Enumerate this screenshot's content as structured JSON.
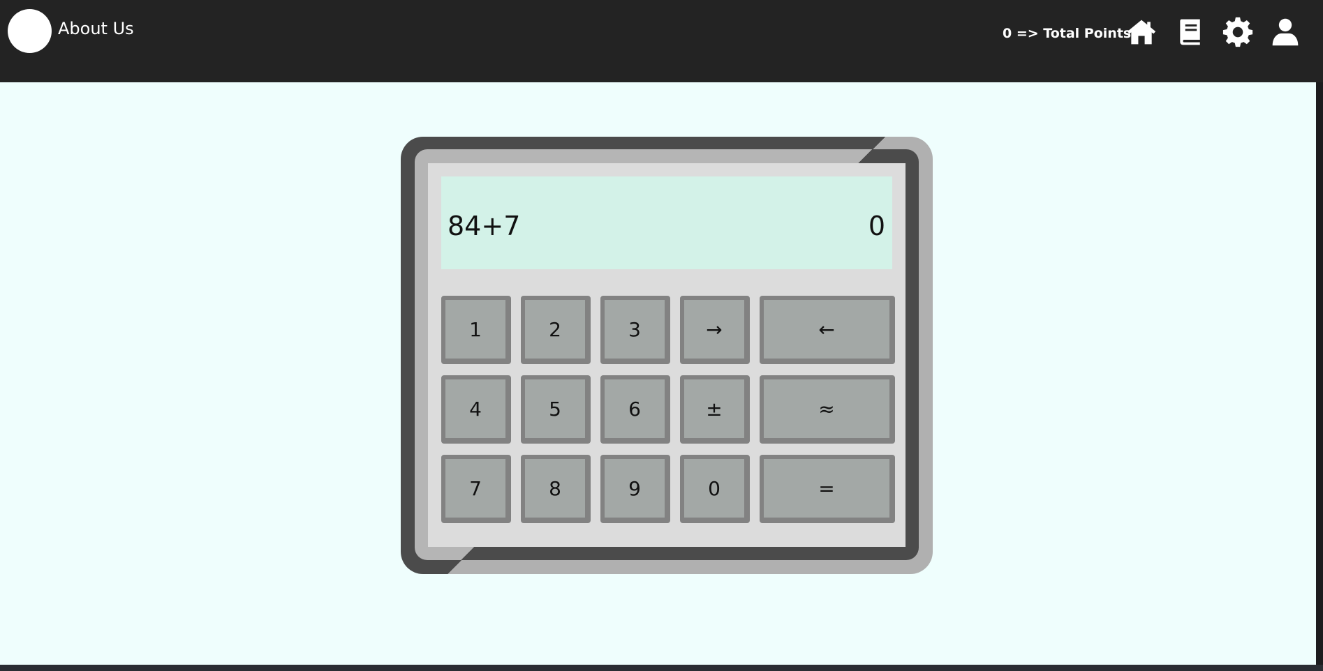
{
  "header": {
    "about_label": "About Us",
    "points_text": "0 => Total Points",
    "icons": [
      "home-icon",
      "book-icon",
      "gear-icon",
      "user-icon"
    ]
  },
  "calculator": {
    "expression": "84+7",
    "result": "0",
    "keys": {
      "k1": "1",
      "k2": "2",
      "k3": "3",
      "right": "→",
      "back": "←",
      "k4": "4",
      "k5": "5",
      "k6": "6",
      "plusminus": "±",
      "approx": "≈",
      "k7": "7",
      "k8": "8",
      "k9": "9",
      "k0": "0",
      "equals": "="
    }
  },
  "colors": {
    "topbar": "#232323",
    "background": "#effefd",
    "display": "#d3f2e8",
    "key": "#a3a8a6"
  }
}
